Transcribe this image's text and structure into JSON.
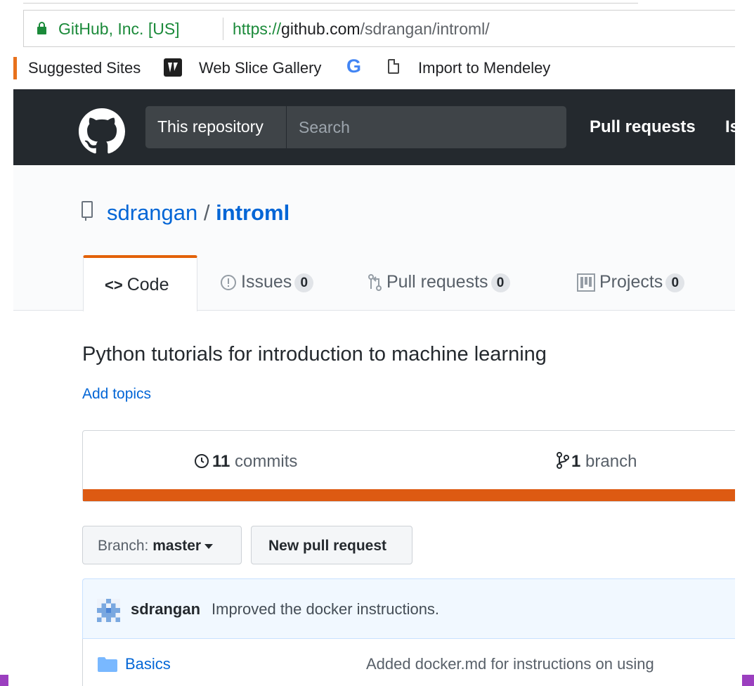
{
  "browser": {
    "security_label": "GitHub, Inc. [US]",
    "url_scheme": "https://",
    "url_host": "github.com",
    "url_path": "/sdrangan/introml/",
    "bookmarks": [
      "Suggested Sites",
      "Web Slice Gallery",
      "Import to Mendeley"
    ],
    "accent_green": "#1b8a3a"
  },
  "header": {
    "search_scope": "This repository",
    "search_placeholder": "Search",
    "nav": [
      "Pull requests",
      "Is"
    ],
    "background": "#24292e"
  },
  "repo": {
    "owner": "sdrangan",
    "separator": "/",
    "name": "introml",
    "tabs": [
      {
        "label": "Code",
        "icon": "code-icon",
        "selected": true
      },
      {
        "label": "Issues",
        "icon": "issue-icon",
        "count": "0"
      },
      {
        "label": "Pull requests",
        "icon": "git-pull-request-icon",
        "count": "0"
      },
      {
        "label": "Projects",
        "icon": "project-icon",
        "count": "0"
      }
    ],
    "description": "Python tutorials for introduction to machine learning",
    "add_topics": "Add topics",
    "stats": {
      "commits_count": "11",
      "commits_label": "commits",
      "branches_count": "1",
      "branches_label": "branch"
    },
    "language_color": "#dd5a12",
    "branch_button": {
      "prefix": "Branch:",
      "value": "master"
    },
    "new_pr_button": "New pull request",
    "latest_commit": {
      "author": "sdrangan",
      "message": "Improved the docker instructions."
    },
    "files": [
      {
        "type": "folder",
        "name": "Basics",
        "message": "Added docker.md for instructions on using"
      }
    ]
  }
}
